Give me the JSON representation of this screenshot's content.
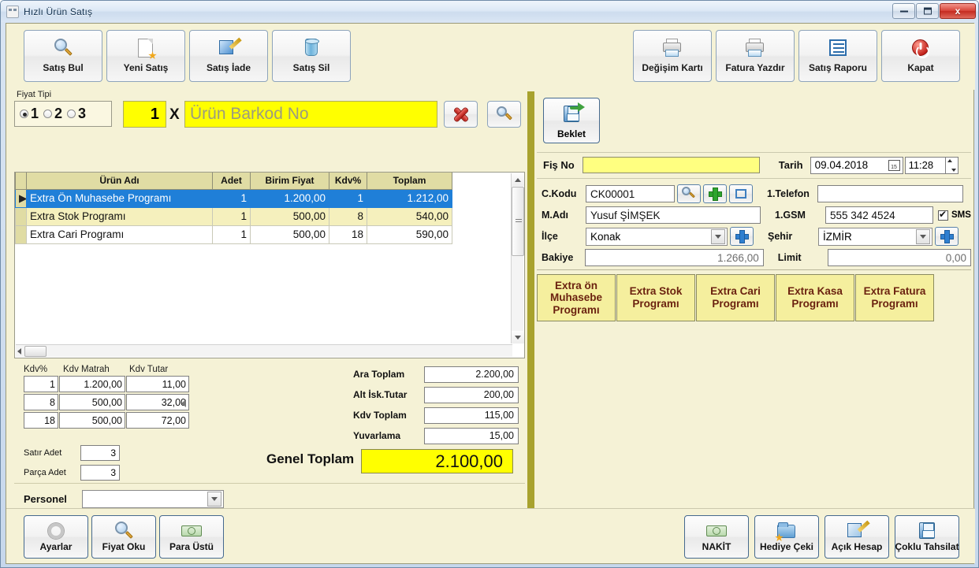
{
  "window": {
    "title": "Hızlı Ürün Satış",
    "icon": "app-icon",
    "minimize": "–",
    "maximize": "❐",
    "close": "x"
  },
  "toolbar": {
    "left_buttons": [
      {
        "label": "Satış Bul",
        "icon": "magnifier-icon"
      },
      {
        "label": "Yeni Satış",
        "icon": "new-page-icon"
      },
      {
        "label": "Satış İade",
        "icon": "edit-page-icon"
      },
      {
        "label": "Satış Sil",
        "icon": "delete-database-icon"
      }
    ],
    "right_buttons": [
      {
        "label": "Değişim Kartı",
        "icon": "printer-icon"
      },
      {
        "label": "Fatura Yazdır",
        "icon": "printer-icon"
      },
      {
        "label": "Satış Raporu",
        "icon": "list-report-icon"
      },
      {
        "label": "Kapat",
        "icon": "power-off-icon"
      }
    ]
  },
  "entry": {
    "price_type_legend": "Fiyat Tipi",
    "price_type_options": [
      "1",
      "2",
      "3"
    ],
    "price_type_selected": "1",
    "quantity_value": "1",
    "multiply_sign": "X",
    "barcode_value": "",
    "barcode_placeholder": "Ürün Barkod No",
    "clear_button_icon": "red-x-icon",
    "search_button_icon": "magnifier-icon"
  },
  "grid": {
    "columns": [
      "Ürün Adı",
      "Adet",
      "Birim Fiyat",
      "Kdv%",
      "Toplam"
    ],
    "rows": [
      {
        "indicator": "▶",
        "name": "Extra Ön Muhasebe Programı",
        "adet": "1",
        "birim_fiyat": "1.200,00",
        "kdv": "1",
        "toplam": "1.212,00",
        "state": "selected"
      },
      {
        "indicator": "",
        "name": "Extra Stok Programı",
        "adet": "1",
        "birim_fiyat": "500,00",
        "kdv": "8",
        "toplam": "540,00",
        "state": "alt"
      },
      {
        "indicator": "",
        "name": "Extra Cari Programı",
        "adet": "1",
        "birim_fiyat": "500,00",
        "kdv": "18",
        "toplam": "590,00",
        "state": "plain"
      }
    ]
  },
  "kdv_table": {
    "headers": [
      "Kdv%",
      "Kdv Matrah",
      "Kdv Tutar"
    ],
    "rows": [
      {
        "oran": "1",
        "matrah": "1.200,00",
        "tutar": "11,00"
      },
      {
        "oran": "8",
        "matrah": "500,00",
        "tutar": "32,00"
      },
      {
        "oran": "18",
        "matrah": "500,00",
        "tutar": "72,00"
      }
    ]
  },
  "totals": [
    {
      "label": "Ara Toplam",
      "value": "2.200,00"
    },
    {
      "label": "Alt İsk.Tutar",
      "value": "200,00"
    },
    {
      "label": "Kdv Toplam",
      "value": "115,00"
    },
    {
      "label": "Yuvarlama",
      "value": "15,00"
    }
  ],
  "counts": [
    {
      "label": "Satır Adet",
      "value": "3"
    },
    {
      "label": "Parça Adet",
      "value": "3"
    }
  ],
  "grand_total": {
    "label": "Genel Toplam",
    "value": "2.100,00",
    "color": "#ffff00"
  },
  "personel": {
    "label": "Personel",
    "value": "",
    "placeholder": ""
  },
  "right_panel": {
    "hold_button": {
      "label": "Beklet",
      "icon": "save-arrow-icon"
    },
    "receipt": {
      "fis_no_label": "Fiş No",
      "fis_no_value": "",
      "tarih_label": "Tarih",
      "tarih_value": "09.04.2018",
      "calendar_icon": "calendar-icon",
      "saat_value": "11:28"
    },
    "customer": {
      "code_label": "C.Kodu",
      "code_value": "CK00001",
      "code_search_icon": "magnifier-icon",
      "code_add_icon": "plus-green-icon",
      "code_window_icon": "window-icon",
      "phone_label": "1.Telefon",
      "phone_value": "",
      "name_label": "M.Adı",
      "name_value": "Yusuf ŞİMŞEK",
      "gsm_label": "1.GSM",
      "gsm_value": "555 342 4524",
      "sms_label": "SMS",
      "sms_checked": true,
      "district_label": "İlçe",
      "district_value": "Konak",
      "district_add_icon": "plus-blue-icon",
      "city_label": "Şehir",
      "city_value": "İZMİR",
      "city_add_icon": "plus-blue-icon",
      "balance_label": "Bakiye",
      "balance_value": "1.266,00",
      "limit_label": "Limit",
      "limit_value": "0,00"
    },
    "program_buttons": [
      "Extra ön Muhasebe Programı",
      "Extra Stok Programı",
      "Extra Cari Programı",
      "Extra Kasa Programı",
      "Extra Fatura Programı"
    ]
  },
  "bottom_toolbar": {
    "left_buttons": [
      {
        "label": "Ayarlar",
        "icon": "gear-icon"
      },
      {
        "label": "Fiyat Oku",
        "icon": "magnifier-icon"
      },
      {
        "label": "Para Üstü",
        "icon": "money-icon"
      }
    ],
    "right_buttons": [
      {
        "label": "NAKİT",
        "icon": "banknote-icon"
      },
      {
        "label": "Hediye Çeki",
        "icon": "gift-folder-icon"
      },
      {
        "label": "Açık Hesap",
        "icon": "edit-note-icon"
      },
      {
        "label": "Çoklu Tahsilat",
        "icon": "floppy-icon"
      }
    ]
  },
  "colors": {
    "form_background": "#f5f2d6",
    "divider": "#a8a22e",
    "highlight_row": "#1f7fd8",
    "yellow_field": "#ffff00",
    "program_button": "#f5ef9e",
    "program_button_text": "#6b2210"
  }
}
